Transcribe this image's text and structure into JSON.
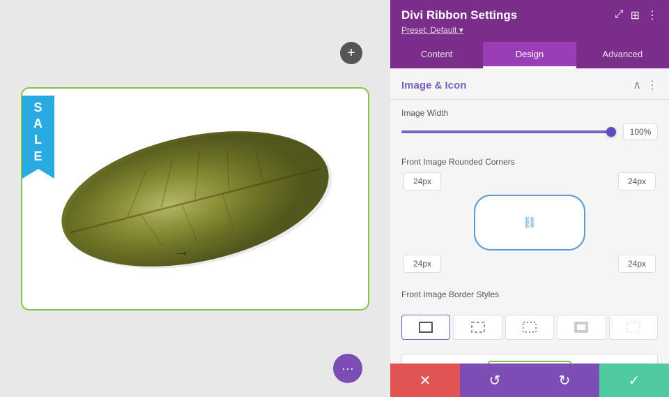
{
  "panel": {
    "title": "Divi Ribbon Settings",
    "preset": "Preset: Default ▾",
    "tabs": [
      {
        "label": "Content",
        "active": false
      },
      {
        "label": "Design",
        "active": true
      },
      {
        "label": "Advanced",
        "active": false
      }
    ],
    "section": {
      "title": "Image & Icon"
    },
    "fields": {
      "imageWidth": {
        "label": "Image Width",
        "value": "100%"
      },
      "roundedCorners": {
        "label": "Front Image Rounded Corners",
        "topLeft": "24px",
        "topRight": "24px",
        "bottomLeft": "24px",
        "bottomRight": "24px"
      },
      "borderStyles": {
        "label": "Front Image Border Styles"
      }
    }
  },
  "actionBar": {
    "cancel": "✕",
    "reset": "↺",
    "redo": "↻",
    "confirm": "✓"
  },
  "canvas": {
    "addBtn": "+",
    "moreBtn": "•••",
    "ribbon": {
      "text": "SALE"
    }
  }
}
